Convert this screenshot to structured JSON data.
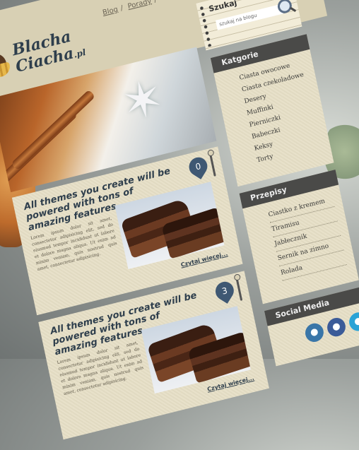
{
  "brand": {
    "name_line1": "Blacha",
    "name_line2": "Ciacha",
    "tld": ".pl"
  },
  "nav": {
    "items": [
      "Blog",
      "Porady"
    ],
    "separator": "/"
  },
  "search": {
    "title": "Szukaj",
    "placeholder": "szukaj na blogu"
  },
  "posts": [
    {
      "title": "All themes you create will be powered with tons of amazing features",
      "excerpt": "Lorem ipsum dolor sit amet, consectetur adipisicing elit, sed do eiusmod tempor incididunt ut labore et dolore magna aliqua. Ut enim ad minim veniam, quis nostrud quis amet, consectetur adipisicing.",
      "comments": "0",
      "read_more": "Czytaj więcej..."
    },
    {
      "title": "All themes you create will be powered with tons of amazing features",
      "excerpt": "Lorem ipsum dolor sit amet, consectetur adipisicing elit, sed do eiusmod tempor incididunt ut labore et dolore magna aliqua. Ut enim ad minim veniam, quis nostrud quis amet, consectetur adipisicing.",
      "comments": "3",
      "read_more": "Czytaj więcej..."
    }
  ],
  "categories": {
    "title": "Katgorie",
    "items": [
      "Ciasta owocowe",
      "Ciasta czekoladowe",
      "Desery",
      "Muffinki",
      "Pierniczki",
      "Babeczki",
      "Keksy",
      "Torty"
    ]
  },
  "recipes": {
    "title": "Przepisy",
    "items": [
      "Ciastko z kremem",
      "Tiramisu",
      "Jabłecznik",
      "Sernik na zimno",
      "Rolada"
    ]
  },
  "social": {
    "title": "Social Media"
  },
  "colors": {
    "accent": "#3f5873",
    "paper": "#e6dfc6",
    "sidebar_header": "#4a4a48",
    "title": "#2e3e4c"
  }
}
